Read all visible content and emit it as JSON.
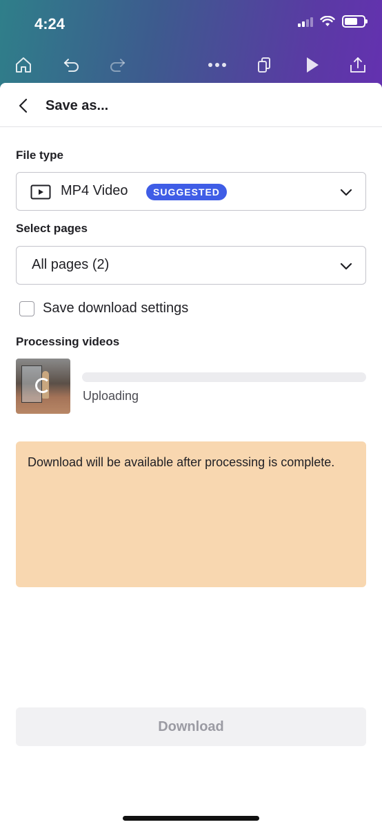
{
  "status_bar": {
    "time": "4:24"
  },
  "toolbar": {
    "icons": [
      "home-icon",
      "undo-icon",
      "redo-icon",
      "more-icon",
      "pages-icon",
      "play-icon",
      "share-icon"
    ]
  },
  "sheet": {
    "title": "Save as...",
    "file_type": {
      "label": "File type",
      "value": "MP4 Video",
      "badge": "SUGGESTED"
    },
    "select_pages": {
      "label": "Select pages",
      "value": "All pages (2)"
    },
    "save_settings": {
      "label": "Save download settings",
      "checked": false
    },
    "processing": {
      "label": "Processing videos",
      "status": "Uploading",
      "progress": 0
    },
    "notice": "Download will be available after processing is complete.",
    "download_label": "Download"
  },
  "colors": {
    "badge": "#3f5de6",
    "notice_bg": "#f8d7b0",
    "download_bg": "#f1f1f3",
    "gradient_start": "#2f7f8a",
    "gradient_end": "#6431b0"
  }
}
